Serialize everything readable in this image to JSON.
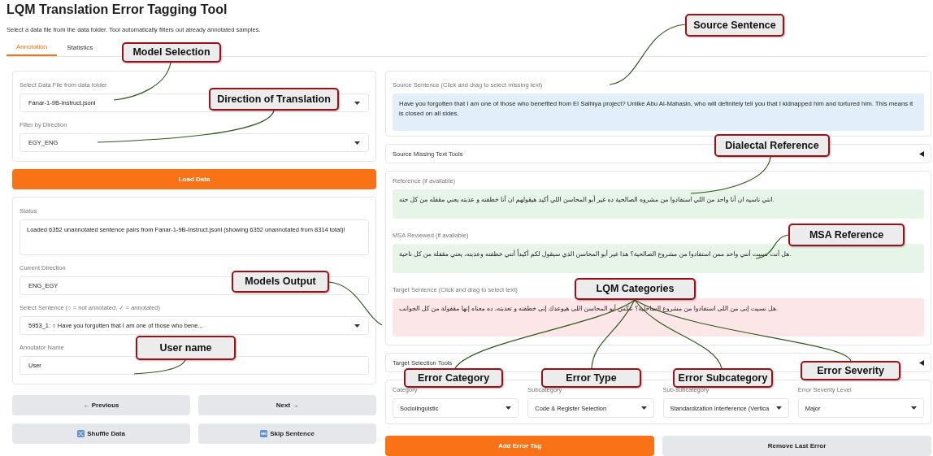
{
  "title": "LQM Translation Error Tagging Tool",
  "subtitle": "Select a data file from the data folder. Tool automatically filters out already annotated samples.",
  "tabs": [
    {
      "label": "Annotation",
      "selected": true
    },
    {
      "label": "Statistics",
      "selected": false
    }
  ],
  "left": {
    "filters": [
      {
        "label": "Select Data File from data folder",
        "value": "Fanar-1-9B-Instruct.jsonl"
      },
      {
        "label": "Filter by Direction",
        "value": "EGY_ENG"
      }
    ],
    "load_button": "Load Data",
    "fields": [
      {
        "label": "Status",
        "value": "Loaded 6352 unannotated sentence pairs from Fanar-1-9B-Instruct.jsonl (showing 6352 unannotated from 8314 total)!",
        "kind": "multiline"
      },
      {
        "label": "Current Direction",
        "value": "ENG_EGY",
        "kind": "text"
      },
      {
        "label": "Select Sentence (○ = not annotated, ✓ = annotated)",
        "value": "5953_1: ○ Have you forgotten that I am one of those who bene...",
        "kind": "select"
      },
      {
        "label": "Annotator Name",
        "value": "User",
        "kind": "input"
      }
    ],
    "buttons": [
      {
        "label": "← Previous",
        "kind": "plain"
      },
      {
        "label": "Next →",
        "kind": "plain"
      },
      {
        "label": "Shuffle Data",
        "kind": "shuffle"
      },
      {
        "label": "Skip Sentence",
        "kind": "skip"
      }
    ]
  },
  "right": {
    "source": {
      "label": "Source Sentence (Click and drag to select missing text)",
      "text": "Have you forgotten that I am one of those who benefited from El Salhiya project? Unlike Abu Al-Mahasin, who will definitely tell you that I kidnapped him and tortured him. This means it is closed on all sides."
    },
    "source_tools": {
      "label": "Source Missing Text Tools",
      "expanded": false
    },
    "references": [
      {
        "label": "Reference (if available)",
        "text": "انتي ناسيه ان أنا واحد من اللي استفادوا من مشروه الصالحية ده غير أبو المحاسن اللي أكيد هيقولهم ان أنا خطفته و عذبته يعني مقفله من كل حته.",
        "kind": "reference"
      },
      {
        "label": "MSA Reviewed (if available)",
        "text": "هل أنت نسيت أنني واحد ممن استفادوا من مشروع الصالحية؟ هذا غير أبو المحاسن الذي سيقول لكم أكيداً أنني خطفته وعذبته، يعني مقفلة من كل ناحية.",
        "kind": "reference"
      },
      {
        "label": "Target Sentence (Click and drag to select text)",
        "text": "هل نسيت إنى من اللى استفادوا من مشروع الساحلية؟ عكس أبو المحاسن اللى هيوعدك إنى خطفته و تعذبته، ده معناه إنها مقفولة من كل الجوانب.",
        "kind": "target"
      }
    ],
    "target_tools": {
      "label": "Target Selection Tools",
      "expanded": false
    },
    "selects": [
      {
        "label": "Category",
        "value": "Sociolinguistic"
      },
      {
        "label": "Subcategory",
        "value": "Code & Register Selection"
      },
      {
        "label": "Sub-subcategory",
        "value": "Standardization Interference (Vertica"
      },
      {
        "label": "Error Severity Level",
        "value": "Major"
      }
    ],
    "buttons": [
      {
        "label": "Add Error Tag",
        "kind": "primary"
      },
      {
        "label": "Remove Last Error",
        "kind": "secondary"
      }
    ]
  },
  "callouts": [
    {
      "text": "Model Selection"
    },
    {
      "text": "Direction of Translation"
    },
    {
      "text": "Models Output"
    },
    {
      "text": "User name"
    },
    {
      "text": "Source Sentence"
    },
    {
      "text": "Dialectal Reference"
    },
    {
      "text": "MSA Reference"
    },
    {
      "text": "LQM Categories"
    },
    {
      "text": "Error Category"
    },
    {
      "text": "Error Type"
    },
    {
      "text": "Error Subcategory"
    },
    {
      "text": "Error Severity"
    }
  ]
}
